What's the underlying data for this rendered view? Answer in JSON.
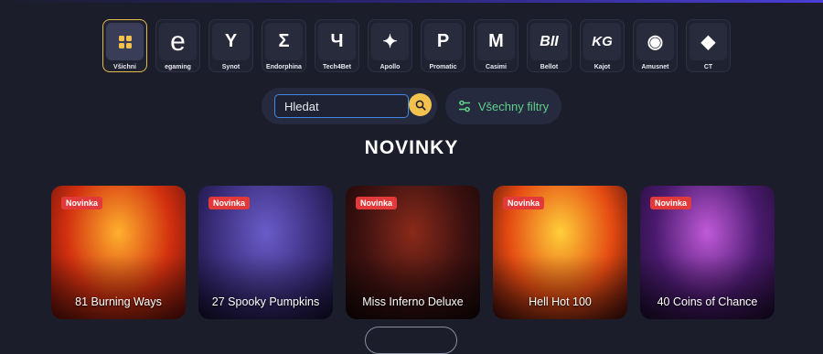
{
  "providers": [
    {
      "label": "Všichni",
      "icon": "grid-icon",
      "glyph": ""
    },
    {
      "label": "egaming",
      "icon": "egaming-logo-icon",
      "glyph": "e"
    },
    {
      "label": "Synot",
      "icon": "synot-logo-icon",
      "glyph": "Y"
    },
    {
      "label": "Endorphina",
      "icon": "endorphina-logo-icon",
      "glyph": "Σ"
    },
    {
      "label": "Tech4Bet",
      "icon": "tech4bet-logo-icon",
      "glyph": "Ч"
    },
    {
      "label": "Apollo",
      "icon": "apollo-star-icon",
      "glyph": "✦"
    },
    {
      "label": "Promatic",
      "icon": "promatic-logo-icon",
      "glyph": "P"
    },
    {
      "label": "Casimi",
      "icon": "casimi-logo-icon",
      "glyph": "M"
    },
    {
      "label": "Bellot",
      "icon": "bellot-logo-icon",
      "glyph": "BII"
    },
    {
      "label": "Kajot",
      "icon": "kajot-logo-icon",
      "glyph": "KG"
    },
    {
      "label": "Amusnet",
      "icon": "amusnet-eye-icon",
      "glyph": "◉"
    },
    {
      "label": "CT",
      "icon": "ct-logo-icon",
      "glyph": "◆"
    }
  ],
  "search": {
    "value": "Hledat",
    "icon": "search-icon"
  },
  "filters": {
    "label": "Všechny filtry",
    "icon": "filter-sliders-icon"
  },
  "section": {
    "title": "NOVINKY"
  },
  "games": [
    {
      "badge": "Novinka",
      "title": "81 Burning Ways",
      "colors": [
        "#ffb02e",
        "#d2300f",
        "#5a0d0a"
      ]
    },
    {
      "badge": "Novinka",
      "title": "27 Spooky Pumpkins",
      "colors": [
        "#6a5cc9",
        "#3a2d7a",
        "#120d2c"
      ]
    },
    {
      "badge": "Novinka",
      "title": "Miss Inferno Deluxe",
      "colors": [
        "#8a2a1a",
        "#3c1110",
        "#120606"
      ]
    },
    {
      "badge": "Novinka",
      "title": "Hell Hot 100",
      "colors": [
        "#ffcf3a",
        "#e44a12",
        "#3a0a0a"
      ]
    },
    {
      "badge": "Novinka",
      "title": "40 Coins of Chance",
      "colors": [
        "#c05ad8",
        "#4a1a6e",
        "#1a0b2a"
      ]
    }
  ],
  "colors": {
    "background": "#1b1d2b",
    "accent_gold": "#f2c14e",
    "badge_red": "#e23a3a",
    "filter_green": "#5fd08a",
    "search_border": "#3f8ae0"
  }
}
